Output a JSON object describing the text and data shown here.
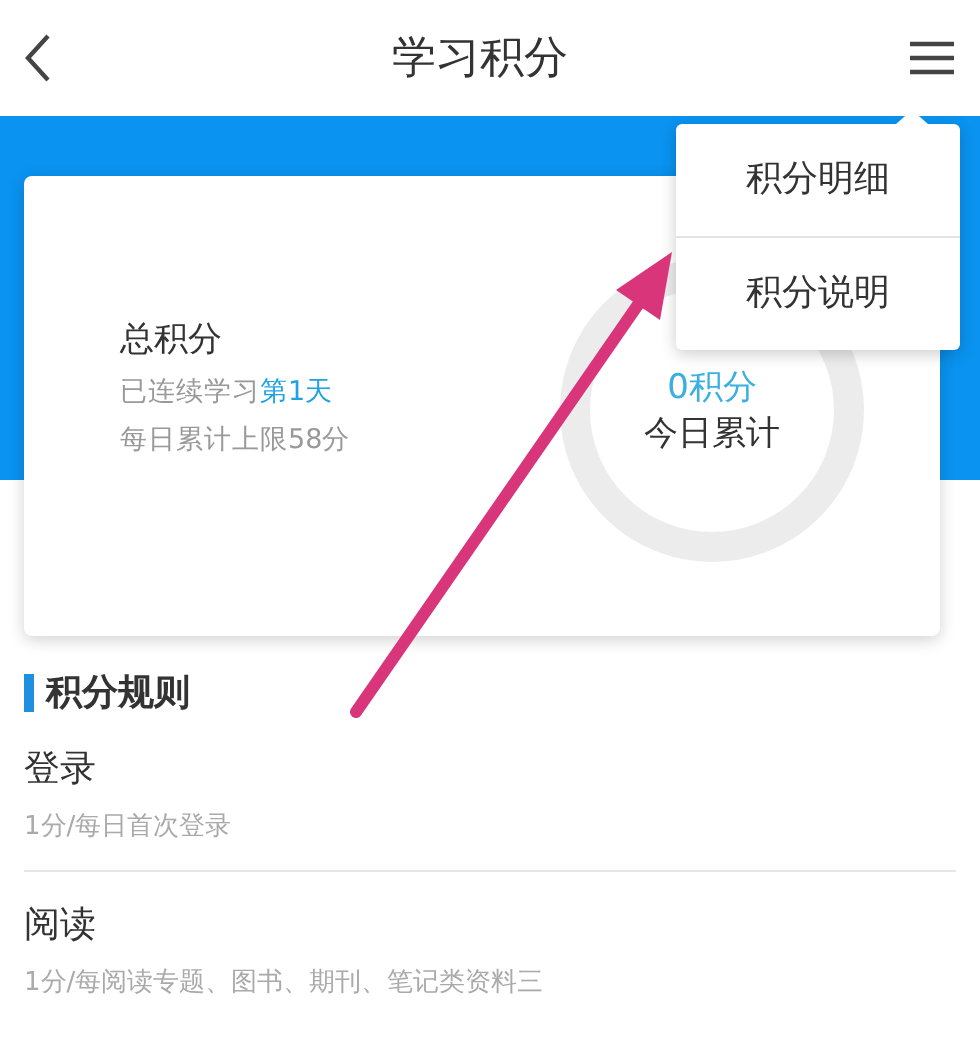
{
  "header": {
    "title": "学习积分"
  },
  "menu": {
    "items": [
      {
        "label": "积分明细"
      },
      {
        "label": "积分说明"
      }
    ]
  },
  "card": {
    "title": "总积分",
    "streak_prefix": "已连续学习",
    "streak_value": "第1天",
    "limit": "每日累计上限58分",
    "today_points": "0积分",
    "today_label": "今日累计"
  },
  "rules": {
    "title": "积分规则",
    "items": [
      {
        "name": "登录",
        "desc": "1分/每日首次登录"
      },
      {
        "name": "阅读",
        "desc": "1分/每阅读专题、图书、期刊、笔记类资料三"
      }
    ]
  }
}
